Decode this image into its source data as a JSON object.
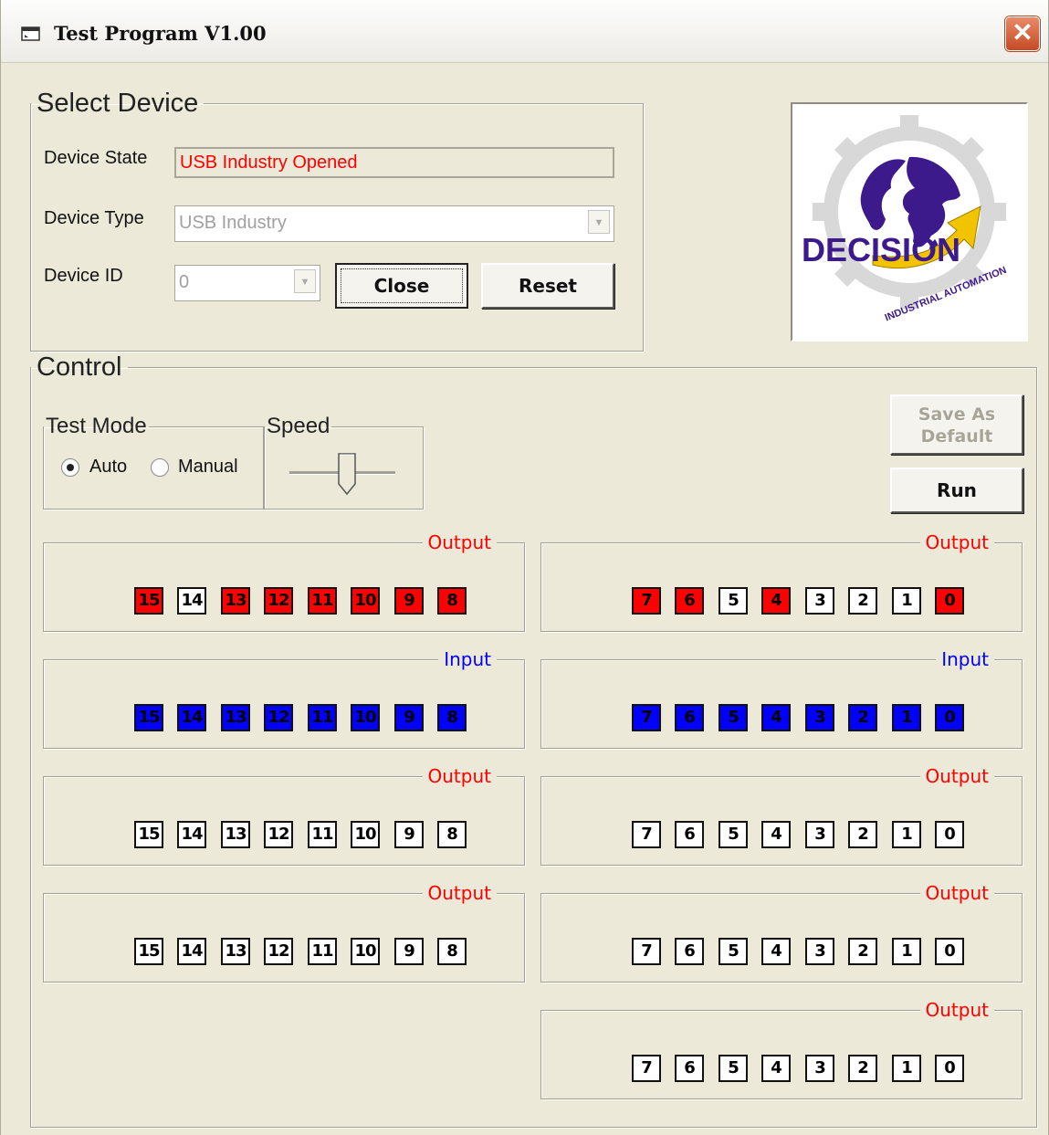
{
  "window": {
    "title": "Test Program V1.00",
    "close_glyph": "✕"
  },
  "select_device": {
    "legend": "Select Device",
    "state_label": "Device State",
    "state_value": "USB Industry Opened",
    "type_label": "Device Type",
    "type_value": "USB Industry",
    "id_label": "Device ID",
    "id_value": "0",
    "close_label": "Close",
    "reset_label": "Reset"
  },
  "logo": {
    "text": "DECISION",
    "subtext": "INDUSTRIAL AUTOMATION"
  },
  "control": {
    "legend": "Control",
    "test_mode": {
      "legend": "Test Mode",
      "auto_label": "Auto",
      "manual_label": "Manual",
      "selected": "Auto"
    },
    "speed": {
      "legend": "Speed",
      "level": 0.55
    },
    "save_default_line1": "Save As",
    "save_default_line2": "Default",
    "run_label": "Run"
  },
  "panels": [
    {
      "title": "Output",
      "kind": "output",
      "bits": [
        15,
        14,
        13,
        12,
        11,
        10,
        9,
        8
      ],
      "on": [
        15,
        13,
        12,
        11,
        10,
        9,
        8
      ]
    },
    {
      "title": "Output",
      "kind": "output",
      "bits": [
        7,
        6,
        5,
        4,
        3,
        2,
        1,
        0
      ],
      "on": [
        7,
        6,
        4,
        0
      ]
    },
    {
      "title": "Input",
      "kind": "input",
      "bits": [
        15,
        14,
        13,
        12,
        11,
        10,
        9,
        8
      ],
      "on": [
        15,
        14,
        13,
        12,
        11,
        10,
        9,
        8
      ]
    },
    {
      "title": "Input",
      "kind": "input",
      "bits": [
        7,
        6,
        5,
        4,
        3,
        2,
        1,
        0
      ],
      "on": [
        7,
        6,
        5,
        4,
        3,
        2,
        1,
        0
      ]
    },
    {
      "title": "Output",
      "kind": "output",
      "bits": [
        15,
        14,
        13,
        12,
        11,
        10,
        9,
        8
      ],
      "on": []
    },
    {
      "title": "Output",
      "kind": "output",
      "bits": [
        7,
        6,
        5,
        4,
        3,
        2,
        1,
        0
      ],
      "on": []
    },
    {
      "title": "Output",
      "kind": "output",
      "bits": [
        15,
        14,
        13,
        12,
        11,
        10,
        9,
        8
      ],
      "on": []
    },
    {
      "title": "Output",
      "kind": "output",
      "bits": [
        7,
        6,
        5,
        4,
        3,
        2,
        1,
        0
      ],
      "on": []
    },
    {
      "title": "Output",
      "kind": "output",
      "bits": [
        7,
        6,
        5,
        4,
        3,
        2,
        1,
        0
      ],
      "on": []
    }
  ],
  "colors": {
    "output_on": "#ff0000",
    "input_on": "#0000ff",
    "state_text": "#ff0000"
  }
}
